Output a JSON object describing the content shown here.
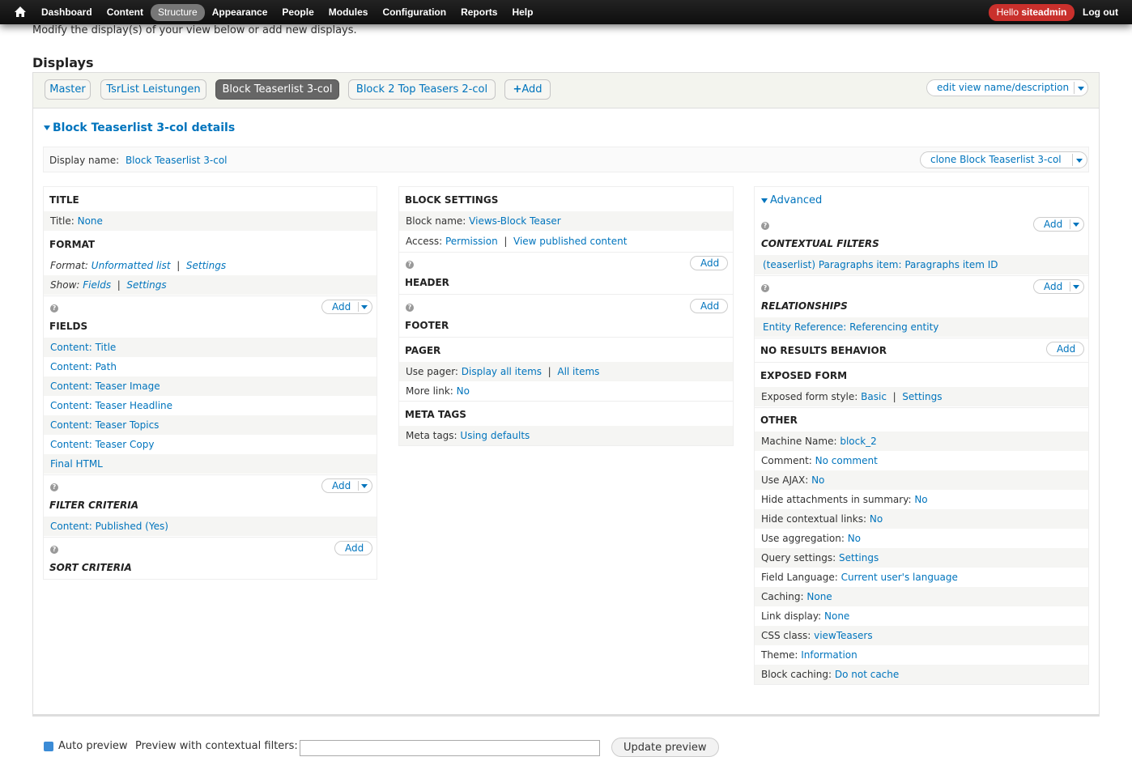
{
  "toolbar": {
    "menu": [
      "Dashboard",
      "Content",
      "Structure",
      "Appearance",
      "People",
      "Modules",
      "Configuration",
      "Reports",
      "Help"
    ],
    "active": "Structure",
    "hello": "Hello",
    "username": "siteadmin",
    "logout": "Log out",
    "user_badge_color": "#c9302c"
  },
  "intro": "Modify the display(s) of your view below or add new displays.",
  "displays_title": "Displays",
  "tabs": {
    "master": "Master",
    "tsrlist": "TsrList Leistungen",
    "block3": "Block Teaserlist 3-col",
    "block2": "Block 2 Top Teasers 2-col",
    "add": "Add",
    "edit_view": "edit view name/description"
  },
  "details": {
    "title": "Block Teaserlist 3-col details",
    "display_name_label": "Display name:",
    "display_name_value": "Block Teaserlist 3-col",
    "clone_label": "clone Block Teaserlist 3-col"
  },
  "col1": {
    "title_hd": "TITLE",
    "title_label": "Title:",
    "title_value": "None",
    "format_hd": "FORMAT",
    "format_label": "Format:",
    "format_value": "Unformatted list",
    "format_settings": "Settings",
    "show_label": "Show:",
    "show_value": "Fields",
    "show_settings": "Settings",
    "add": "Add",
    "fields_hd": "FIELDS",
    "fields": [
      "Content: Title",
      "Content: Path",
      "Content: Teaser Image",
      "Content: Teaser Headline",
      "Content: Teaser Topics",
      "Content: Teaser Copy",
      "Final HTML"
    ],
    "filter_hd": "FILTER CRITERIA",
    "filter_item": "Content: Published (Yes)",
    "sort_hd": "SORT CRITERIA"
  },
  "col2": {
    "block_hd": "BLOCK SETTINGS",
    "block_name_label": "Block name:",
    "block_name_value": "Views-Block Teaser",
    "access_label": "Access:",
    "access_value": "Permission",
    "access_value2": "View published content",
    "add": "Add",
    "header_hd": "HEADER",
    "footer_hd": "FOOTER",
    "pager_hd": "PAGER",
    "use_pager_label": "Use pager:",
    "use_pager_value": "Display all items",
    "use_pager_value2": "All items",
    "more_link_label": "More link:",
    "more_link_value": "No",
    "meta_hd": "META TAGS",
    "meta_label": "Meta tags:",
    "meta_value": "Using defaults"
  },
  "col3": {
    "advanced": "Advanced",
    "add": "Add",
    "contextual_hd": "CONTEXTUAL FILTERS",
    "contextual_item": "(teaserlist) Paragraphs item: Paragraphs item ID",
    "relationships_hd": "RELATIONSHIPS",
    "relationships_item": "Entity Reference: Referencing entity",
    "no_results_hd": "NO RESULTS BEHAVIOR",
    "exposed_hd": "EXPOSED FORM",
    "exposed_label": "Exposed form style:",
    "exposed_value": "Basic",
    "exposed_settings": "Settings",
    "other_hd": "OTHER",
    "other": [
      {
        "label": "Machine Name:",
        "value": "block_2"
      },
      {
        "label": "Comment:",
        "value": "No comment"
      },
      {
        "label": "Use AJAX:",
        "value": "No"
      },
      {
        "label": "Hide attachments in summary:",
        "value": "No"
      },
      {
        "label": "Hide contextual links:",
        "value": "No"
      },
      {
        "label": "Use aggregation:",
        "value": "No"
      },
      {
        "label": "Query settings:",
        "value": "Settings"
      },
      {
        "label": "Field Language:",
        "value": "Current user's language"
      },
      {
        "label": "Caching:",
        "value": "None"
      },
      {
        "label": "Link display:",
        "value": "None"
      },
      {
        "label": "CSS class:",
        "value": "viewTeasers"
      },
      {
        "label": "Theme:",
        "value": "Information"
      },
      {
        "label": "Block caching:",
        "value": "Do not cache"
      }
    ]
  },
  "preview": {
    "auto_preview": "Auto preview",
    "contextual_label": "Preview with contextual filters:",
    "update": "Update preview"
  }
}
